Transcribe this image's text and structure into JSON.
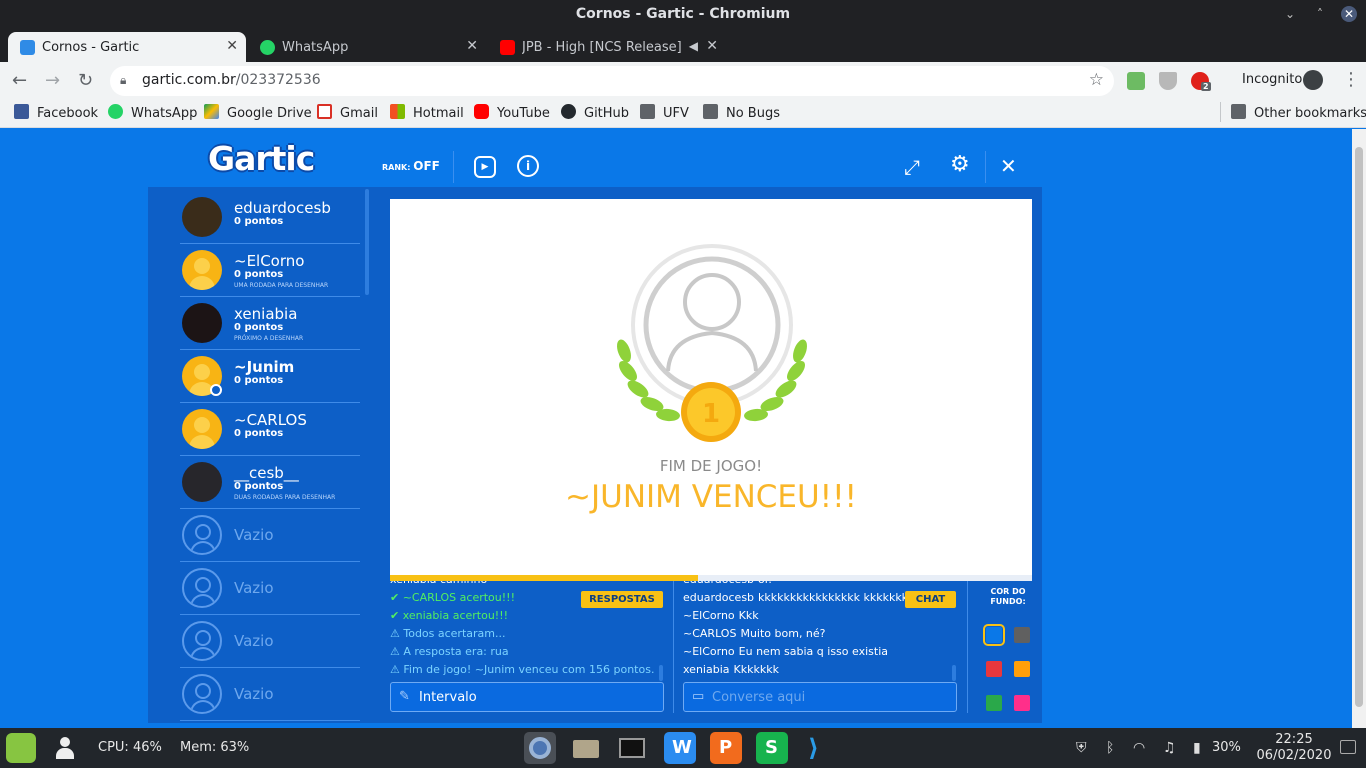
{
  "window": {
    "title": "Cornos - Gartic - Chromium"
  },
  "tabs": [
    {
      "label": "Cornos - Gartic",
      "favicon_color": "#f8c114",
      "active": true
    },
    {
      "label": "WhatsApp",
      "favicon_color": "#25d366",
      "active": false
    },
    {
      "label": "JPB - High [NCS Release] - Y",
      "favicon_color": "#ff0000",
      "active": false
    }
  ],
  "address": {
    "host": "gartic.com.br",
    "path": "/023372536"
  },
  "toolbar": {
    "incognito_label": "Incognito",
    "ext_badge": "2"
  },
  "bookmarks": [
    {
      "label": "Facebook",
      "color": "#3b5998"
    },
    {
      "label": "WhatsApp",
      "color": "#25d366"
    },
    {
      "label": "Google Drive",
      "color": "#fbbc04"
    },
    {
      "label": "Gmail",
      "color": "#d93025"
    },
    {
      "label": "Hotmail",
      "color": "#f25022"
    },
    {
      "label": "YouTube",
      "color": "#ff0000"
    },
    {
      "label": "GitHub",
      "color": "#24292e"
    },
    {
      "label": "UFV",
      "color": "folder"
    },
    {
      "label": "No Bugs",
      "color": "folder"
    }
  ],
  "other_bookmarks": "Other bookmarks",
  "game": {
    "logo": "Gartic",
    "rank_label": "RANK:",
    "rank_value": "OFF",
    "players": [
      {
        "name": "eduardocesb",
        "points": "0 pontos",
        "note": "",
        "avatar": "photo1",
        "me": false
      },
      {
        "name": "~ElCorno",
        "points": "0 pontos",
        "note": "UMA RODADA PARA DESENHAR",
        "avatar": "default",
        "me": false
      },
      {
        "name": "xeniabia",
        "points": "0 pontos",
        "note": "PRÓXIMO A DESENHAR",
        "avatar": "photo2",
        "me": false
      },
      {
        "name": "~Junim",
        "points": "0 pontos",
        "note": "",
        "avatar": "default",
        "me": true
      },
      {
        "name": "~CARLOS",
        "points": "0 pontos",
        "note": "",
        "avatar": "default",
        "me": false
      },
      {
        "name": "__cesb__",
        "points": "0 pontos",
        "note": "DUAS RODADAS PARA DESENHAR",
        "avatar": "photo3",
        "me": false
      },
      {
        "name": "Vazio",
        "points": "",
        "note": "",
        "avatar": "empty",
        "me": false
      },
      {
        "name": "Vazio",
        "points": "",
        "note": "",
        "avatar": "empty",
        "me": false
      },
      {
        "name": "Vazio",
        "points": "",
        "note": "",
        "avatar": "empty",
        "me": false
      },
      {
        "name": "Vazio",
        "points": "",
        "note": "",
        "avatar": "empty",
        "me": false
      }
    ],
    "end_title": "FIM DE JOGO!",
    "winner_text": "~JUNIM VENCEU!!!",
    "medal_number": "1",
    "round_progress": 0.48,
    "answers_button": "RESPOSTAS",
    "answers": [
      {
        "type": "plain",
        "text": "xeniabia caminho"
      },
      {
        "type": "ok",
        "text": "✔ ~CARLOS acertou!!!"
      },
      {
        "type": "ok",
        "text": "✔ xeniabia acertou!!!"
      },
      {
        "type": "info",
        "text": "⚠ Todos acertaram..."
      },
      {
        "type": "info",
        "text": "⚠ A resposta era: rua"
      },
      {
        "type": "info",
        "text": "⚠ Fim de jogo! ~Junim venceu com 156 pontos."
      }
    ],
    "answer_input_value": "Intervalo",
    "chat_button": "CHAT",
    "chat": [
      {
        "name": "eduardocesb",
        "text": "oi!"
      },
      {
        "name": "eduardocesb",
        "text": "kkkkkkkkkkkkkkkk kkkkkkkkkk"
      },
      {
        "name": "~ElCorno",
        "text": "Kkk"
      },
      {
        "name": "~CARLOS",
        "text": "Muito bom, né?"
      },
      {
        "name": "~ElCorno",
        "text": "Eu nem sabia q isso existia"
      },
      {
        "name": "xeniabia",
        "text": "Kkkkkkk"
      }
    ],
    "chat_placeholder": "Converse aqui",
    "bg_color_label_1": "COR DO",
    "bg_color_label_2": "FUNDO:",
    "bg_colors": [
      "#0a78e8",
      "#606060",
      "#e8373d",
      "#ff9f0a",
      "#2aa84a",
      "#ff2f8a"
    ]
  },
  "taskbar": {
    "cpu": "CPU: 46%",
    "mem": "Mem: 63%",
    "battery": "30%",
    "time": "22:25",
    "date": "06/02/2020"
  }
}
